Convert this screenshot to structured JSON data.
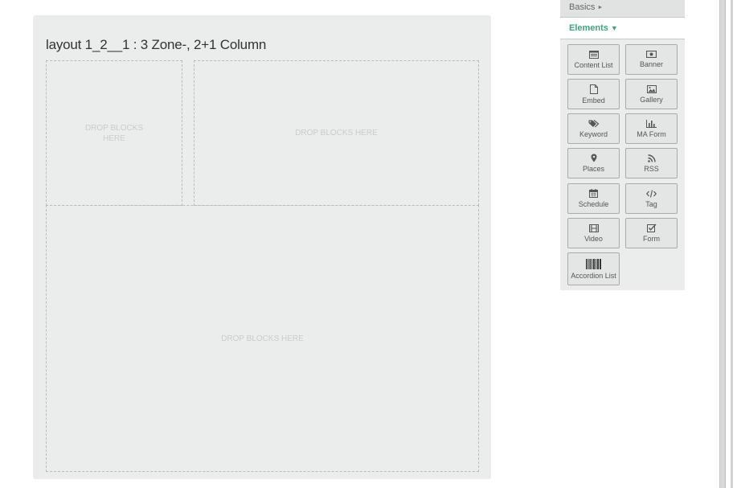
{
  "layout": {
    "title": "layout 1_2__1 : 3 Zone-, 2+1 Column",
    "zones": [
      {
        "label": "DROP BLOCKS HERE"
      },
      {
        "label": "DROP BLOCKS HERE"
      },
      {
        "label": "DROP BLOCKS HERE"
      }
    ]
  },
  "panel": {
    "basics_label": "Basics",
    "basics_arrow": "►",
    "elements_label": "Elements",
    "elements_arrow": "▼",
    "elements": [
      {
        "label": "Content List",
        "icon": "content-list-icon"
      },
      {
        "label": "Banner",
        "icon": "banner-icon"
      },
      {
        "label": "Embed",
        "icon": "embed-icon"
      },
      {
        "label": "Gallery",
        "icon": "gallery-icon"
      },
      {
        "label": "Keyword",
        "icon": "keyword-icon"
      },
      {
        "label": "MA Form",
        "icon": "ma-form-icon"
      },
      {
        "label": "Places",
        "icon": "places-icon"
      },
      {
        "label": "RSS",
        "icon": "rss-icon"
      },
      {
        "label": "Schedule",
        "icon": "schedule-icon"
      },
      {
        "label": "Tag",
        "icon": "tag-icon"
      },
      {
        "label": "Video",
        "icon": "video-icon"
      },
      {
        "label": "Form",
        "icon": "form-icon"
      },
      {
        "label": "Accordion List",
        "icon": "accordion-list-icon"
      }
    ]
  },
  "colors": {
    "accent": "#3aa67c",
    "canvas_bg": "#ebeded"
  }
}
